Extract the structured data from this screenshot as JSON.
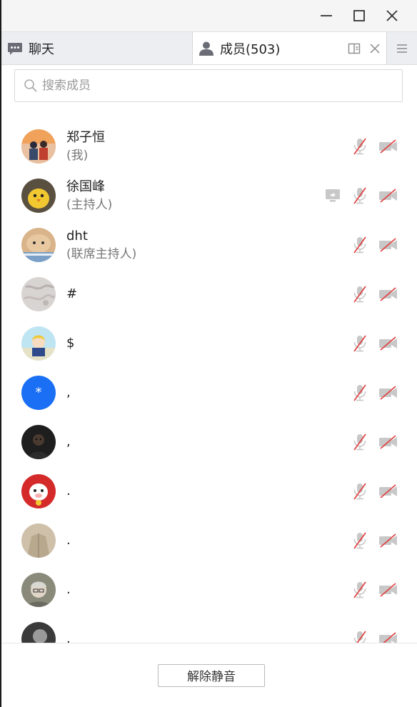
{
  "tabs": {
    "chat_label": "聊天",
    "members_label": "成员(503)"
  },
  "search": {
    "placeholder": "搜索成员"
  },
  "members": [
    {
      "name": "郑子恒",
      "role": "(我)",
      "avatar": "photo-couple"
    },
    {
      "name": "徐国峰",
      "role": "(主持人)",
      "avatar": "photo-chick",
      "screen_share": true
    },
    {
      "name": "dht",
      "role": "(联席主持人)",
      "avatar": "photo-cat"
    },
    {
      "name": "#",
      "role": "",
      "avatar": "photo-grey"
    },
    {
      "name": "$",
      "role": "",
      "avatar": "photo-cartoon"
    },
    {
      "name": ",",
      "role": "",
      "avatar": "blue-asterisk",
      "avatar_text": "*"
    },
    {
      "name": ",",
      "role": "",
      "avatar": "photo-dark"
    },
    {
      "name": ".",
      "role": "",
      "avatar": "photo-red"
    },
    {
      "name": ".",
      "role": "",
      "avatar": "photo-beige"
    },
    {
      "name": ".",
      "role": "",
      "avatar": "photo-old"
    },
    {
      "name": ".",
      "role": "",
      "avatar": "photo-bw"
    }
  ],
  "footer": {
    "unmute_all_label": "解除静音"
  },
  "colors": {
    "muted_red": "#e04040",
    "icon_grey": "#b5b5b5",
    "accent_blue": "#1a6ff5"
  }
}
